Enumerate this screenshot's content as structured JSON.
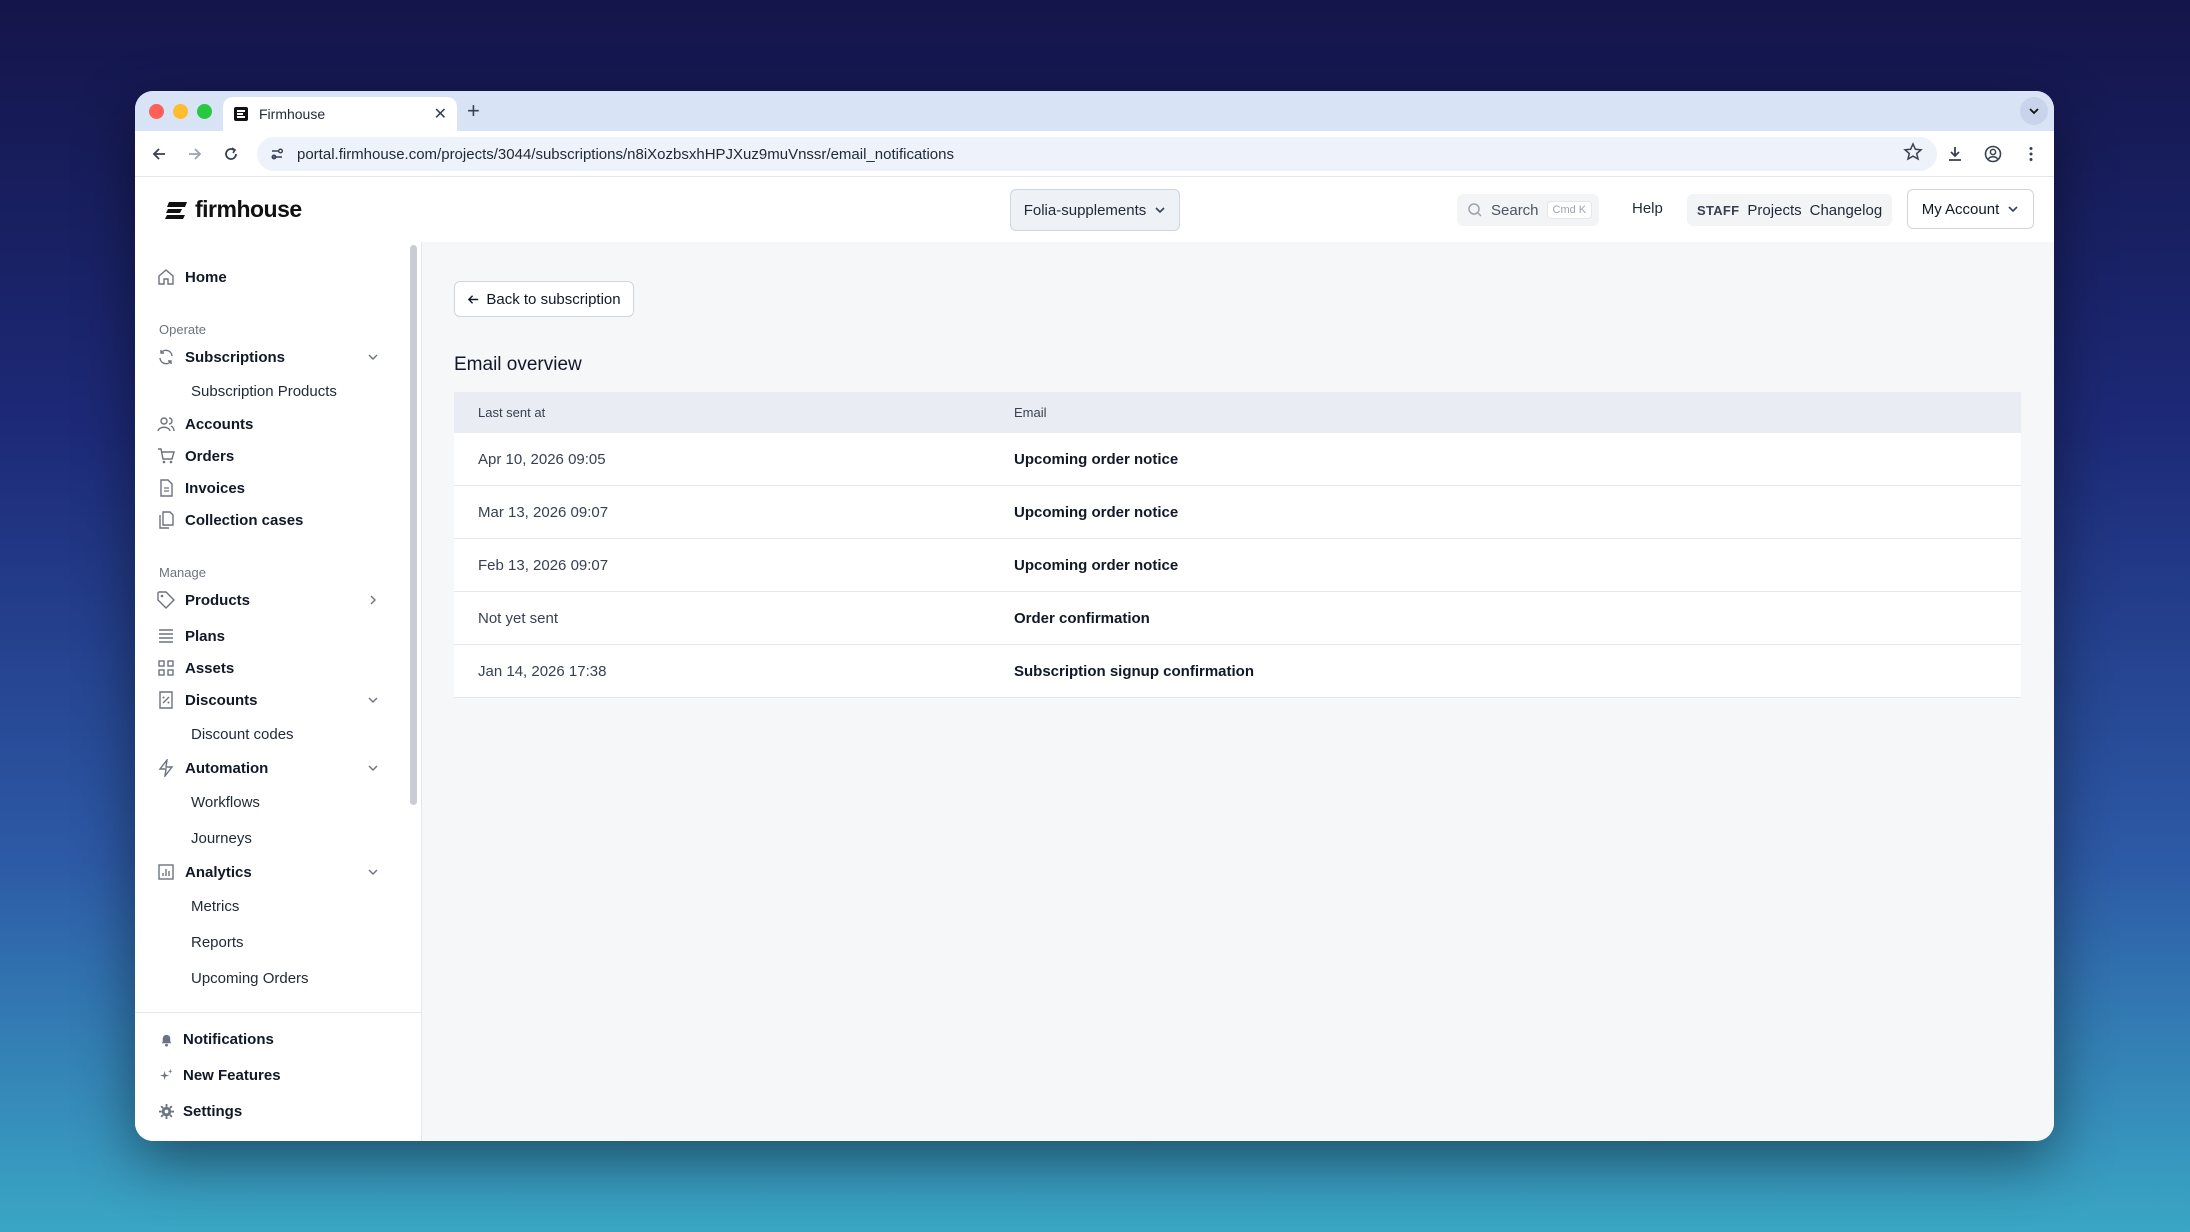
{
  "browser": {
    "tab_title": "Firmhouse",
    "url": "portal.firmhouse.com/projects/3044/subscriptions/n8iXozbsxhHPJXuz9muVnssr/email_notifications"
  },
  "header": {
    "logo": "firmhouse",
    "project": "Folia-supplements",
    "search_label": "Search",
    "search_shortcut": "Cmd K",
    "help": "Help",
    "staff_tag": "STAFF",
    "projects": "Projects",
    "changelog": "Changelog",
    "account": "My Account"
  },
  "sidebar": {
    "home": "Home",
    "section_operate": "Operate",
    "subscriptions": "Subscriptions",
    "subscription_products": "Subscription Products",
    "accounts": "Accounts",
    "orders": "Orders",
    "invoices": "Invoices",
    "collection_cases": "Collection cases",
    "section_manage": "Manage",
    "products": "Products",
    "plans": "Plans",
    "assets": "Assets",
    "discounts": "Discounts",
    "discount_codes": "Discount codes",
    "automation": "Automation",
    "workflows": "Workflows",
    "journeys": "Journeys",
    "analytics": "Analytics",
    "metrics": "Metrics",
    "reports": "Reports",
    "upcoming_orders": "Upcoming Orders",
    "notifications": "Notifications",
    "new_features": "New Features",
    "settings": "Settings"
  },
  "main": {
    "back_label": "Back to subscription",
    "title": "Email overview",
    "columns": [
      "Last sent at",
      "Email"
    ],
    "rows": [
      {
        "sent": "Apr 10, 2026 09:05",
        "email": "Upcoming order notice"
      },
      {
        "sent": "Mar 13, 2026 09:07",
        "email": "Upcoming order notice"
      },
      {
        "sent": "Feb 13, 2026 09:07",
        "email": "Upcoming order notice"
      },
      {
        "sent": "Not yet sent",
        "email": "Order confirmation"
      },
      {
        "sent": "Jan 14, 2026 17:38",
        "email": "Subscription signup confirmation"
      }
    ]
  },
  "colors": {
    "accent": "#2f4fd9",
    "tabstrip": "#d9e3f6",
    "table_header": "#e9edf3"
  }
}
